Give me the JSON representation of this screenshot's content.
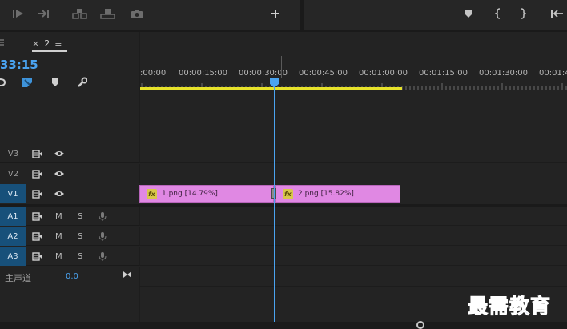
{
  "sequence": {
    "tab_name": "2",
    "timecode": "33:15"
  },
  "ruler": {
    "labels": [
      ":00:00",
      "00:00:15:00",
      "00:00:30:00",
      "00:00:45:00",
      "00:01:00:00",
      "00:01:15:00",
      "00:01:30:00",
      "00:01:4"
    ]
  },
  "tracks": {
    "video": [
      {
        "name": "V3",
        "targeted": false
      },
      {
        "name": "V2",
        "targeted": false
      },
      {
        "name": "V1",
        "targeted": true
      }
    ],
    "audio": [
      {
        "name": "A1",
        "mute": "M",
        "solo": "S"
      },
      {
        "name": "A2",
        "mute": "M",
        "solo": "S"
      },
      {
        "name": "A3",
        "mute": "M",
        "solo": "S"
      }
    ],
    "master": {
      "label": "主声道",
      "value": "0.0"
    }
  },
  "clips": [
    {
      "label": "1.png [14.79%]",
      "fx": "fx",
      "color": "#e088e3"
    },
    {
      "label": "2.png [15.82%]",
      "fx": "fx",
      "color": "#e088e3"
    }
  ],
  "colors": {
    "accent": "#4aa3f0",
    "workarea": "#e6e22a",
    "clip": "#e088e3",
    "track_target": "#17507a"
  },
  "watermark": "最需教育"
}
